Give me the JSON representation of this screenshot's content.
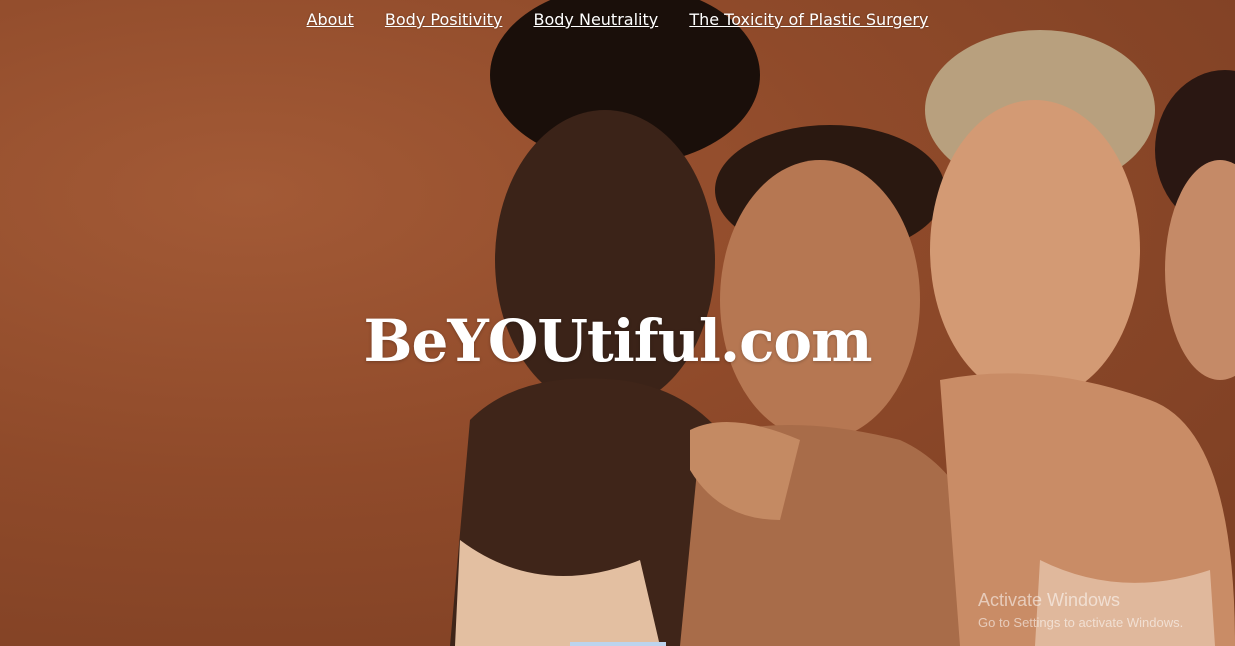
{
  "nav": {
    "items": [
      {
        "label": "About"
      },
      {
        "label": "Body Positivity"
      },
      {
        "label": "Body Neutrality"
      },
      {
        "label": "The Toxicity of Plastic Surgery"
      }
    ]
  },
  "hero": {
    "title": "BeYOUtiful.com",
    "background_color": "#8f4a2a"
  },
  "os_watermark": {
    "title": "Activate Windows",
    "subtitle": "Go to Settings to activate Windows."
  },
  "colors": {
    "nav_text": "#ffffff",
    "title_text": "#ffffff",
    "backdrop": "#8f4a2a"
  }
}
